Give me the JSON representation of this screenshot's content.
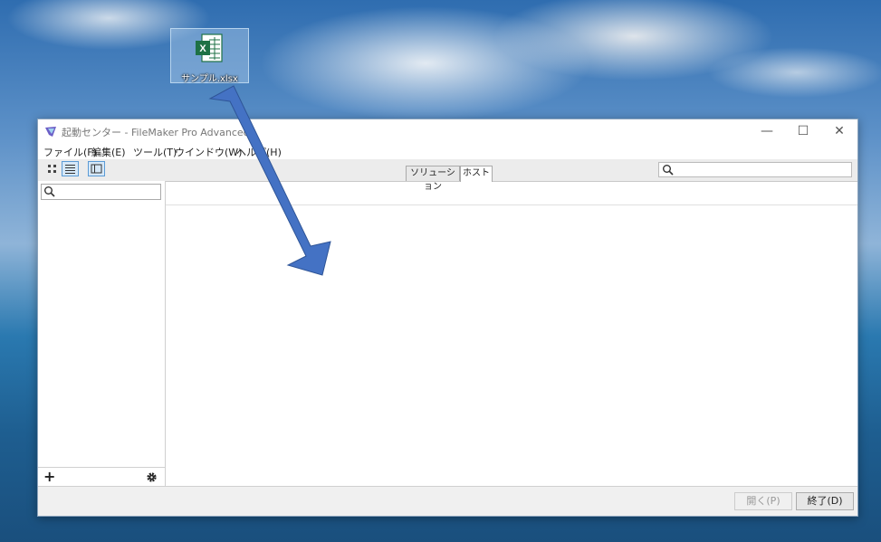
{
  "desktop": {
    "file_icon_label": "サンプル.xlsx",
    "file_icon_type": "excel-icon"
  },
  "window": {
    "title": "起動センター - FileMaker Pro Advanced",
    "minimize_glyph": "—",
    "maximize_glyph": "☐",
    "close_glyph": "✕"
  },
  "menubar": {
    "items": [
      "ファイル(F)",
      "編集(E)",
      "ツール(T)",
      "ウインドウ(W)",
      "ヘルプ(H)"
    ]
  },
  "toolbar": {
    "tabs": [
      "ソリューション",
      "ホスト"
    ],
    "selected_tab": "ホスト",
    "search_placeholder": ""
  },
  "sidebar": {
    "search_placeholder": "",
    "add_glyph": "+",
    "settings_glyph": "✿"
  },
  "footer": {
    "open_label": "開く(P)",
    "quit_label": "終了(D)"
  },
  "colors": {
    "arrow_fill": "#4472c4",
    "selection": "#5b9bd5"
  }
}
